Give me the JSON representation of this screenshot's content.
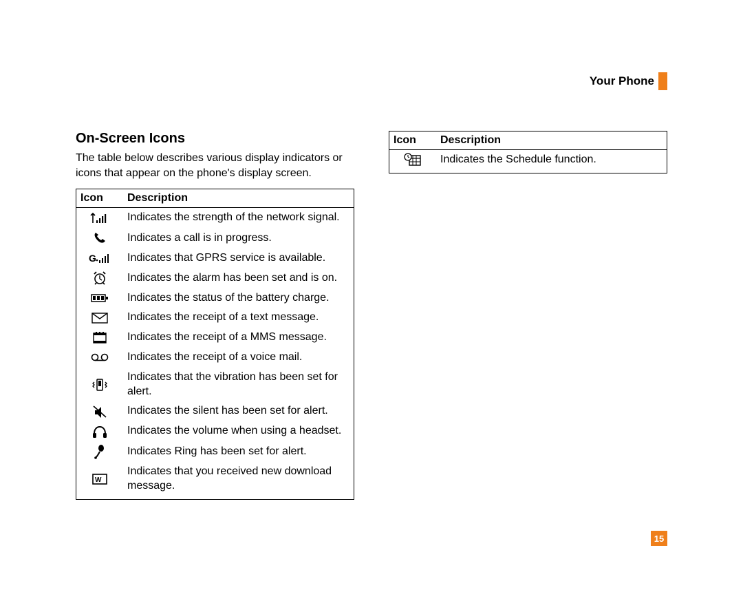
{
  "header": {
    "title": "Your Phone"
  },
  "section": {
    "title": "On-Screen Icons",
    "intro": "The table below describes various display indicators or icons that appear on the phone's display screen."
  },
  "table_left": {
    "col_icon": "Icon",
    "col_desc": "Description",
    "rows": [
      {
        "icon": "signal-icon",
        "desc": "Indicates the strength of the network signal."
      },
      {
        "icon": "call-icon",
        "desc": "Indicates a call is in progress."
      },
      {
        "icon": "gprs-icon",
        "desc": "Indicates that GPRS service is available."
      },
      {
        "icon": "alarm-icon",
        "desc": "Indicates the alarm has been set and is on."
      },
      {
        "icon": "battery-icon",
        "desc": "Indicates the status of the battery charge."
      },
      {
        "icon": "text-msg-icon",
        "desc": "Indicates the receipt of a text message."
      },
      {
        "icon": "mms-msg-icon",
        "desc": "Indicates the receipt of a MMS message."
      },
      {
        "icon": "voicemail-icon",
        "desc": "Indicates the receipt of a voice mail."
      },
      {
        "icon": "vibrate-icon",
        "desc": "Indicates that the vibration has been set for alert."
      },
      {
        "icon": "silent-icon",
        "desc": "Indicates the silent has been set for alert."
      },
      {
        "icon": "headset-icon",
        "desc": "Indicates the volume when using a headset."
      },
      {
        "icon": "ring-icon",
        "desc": "Indicates Ring has been set for alert."
      },
      {
        "icon": "download-icon",
        "desc": "Indicates that you received new download message."
      }
    ]
  },
  "table_right": {
    "col_icon": "Icon",
    "col_desc": "Description",
    "rows": [
      {
        "icon": "schedule-icon",
        "desc": "Indicates the Schedule function."
      }
    ]
  },
  "page_number": "15"
}
